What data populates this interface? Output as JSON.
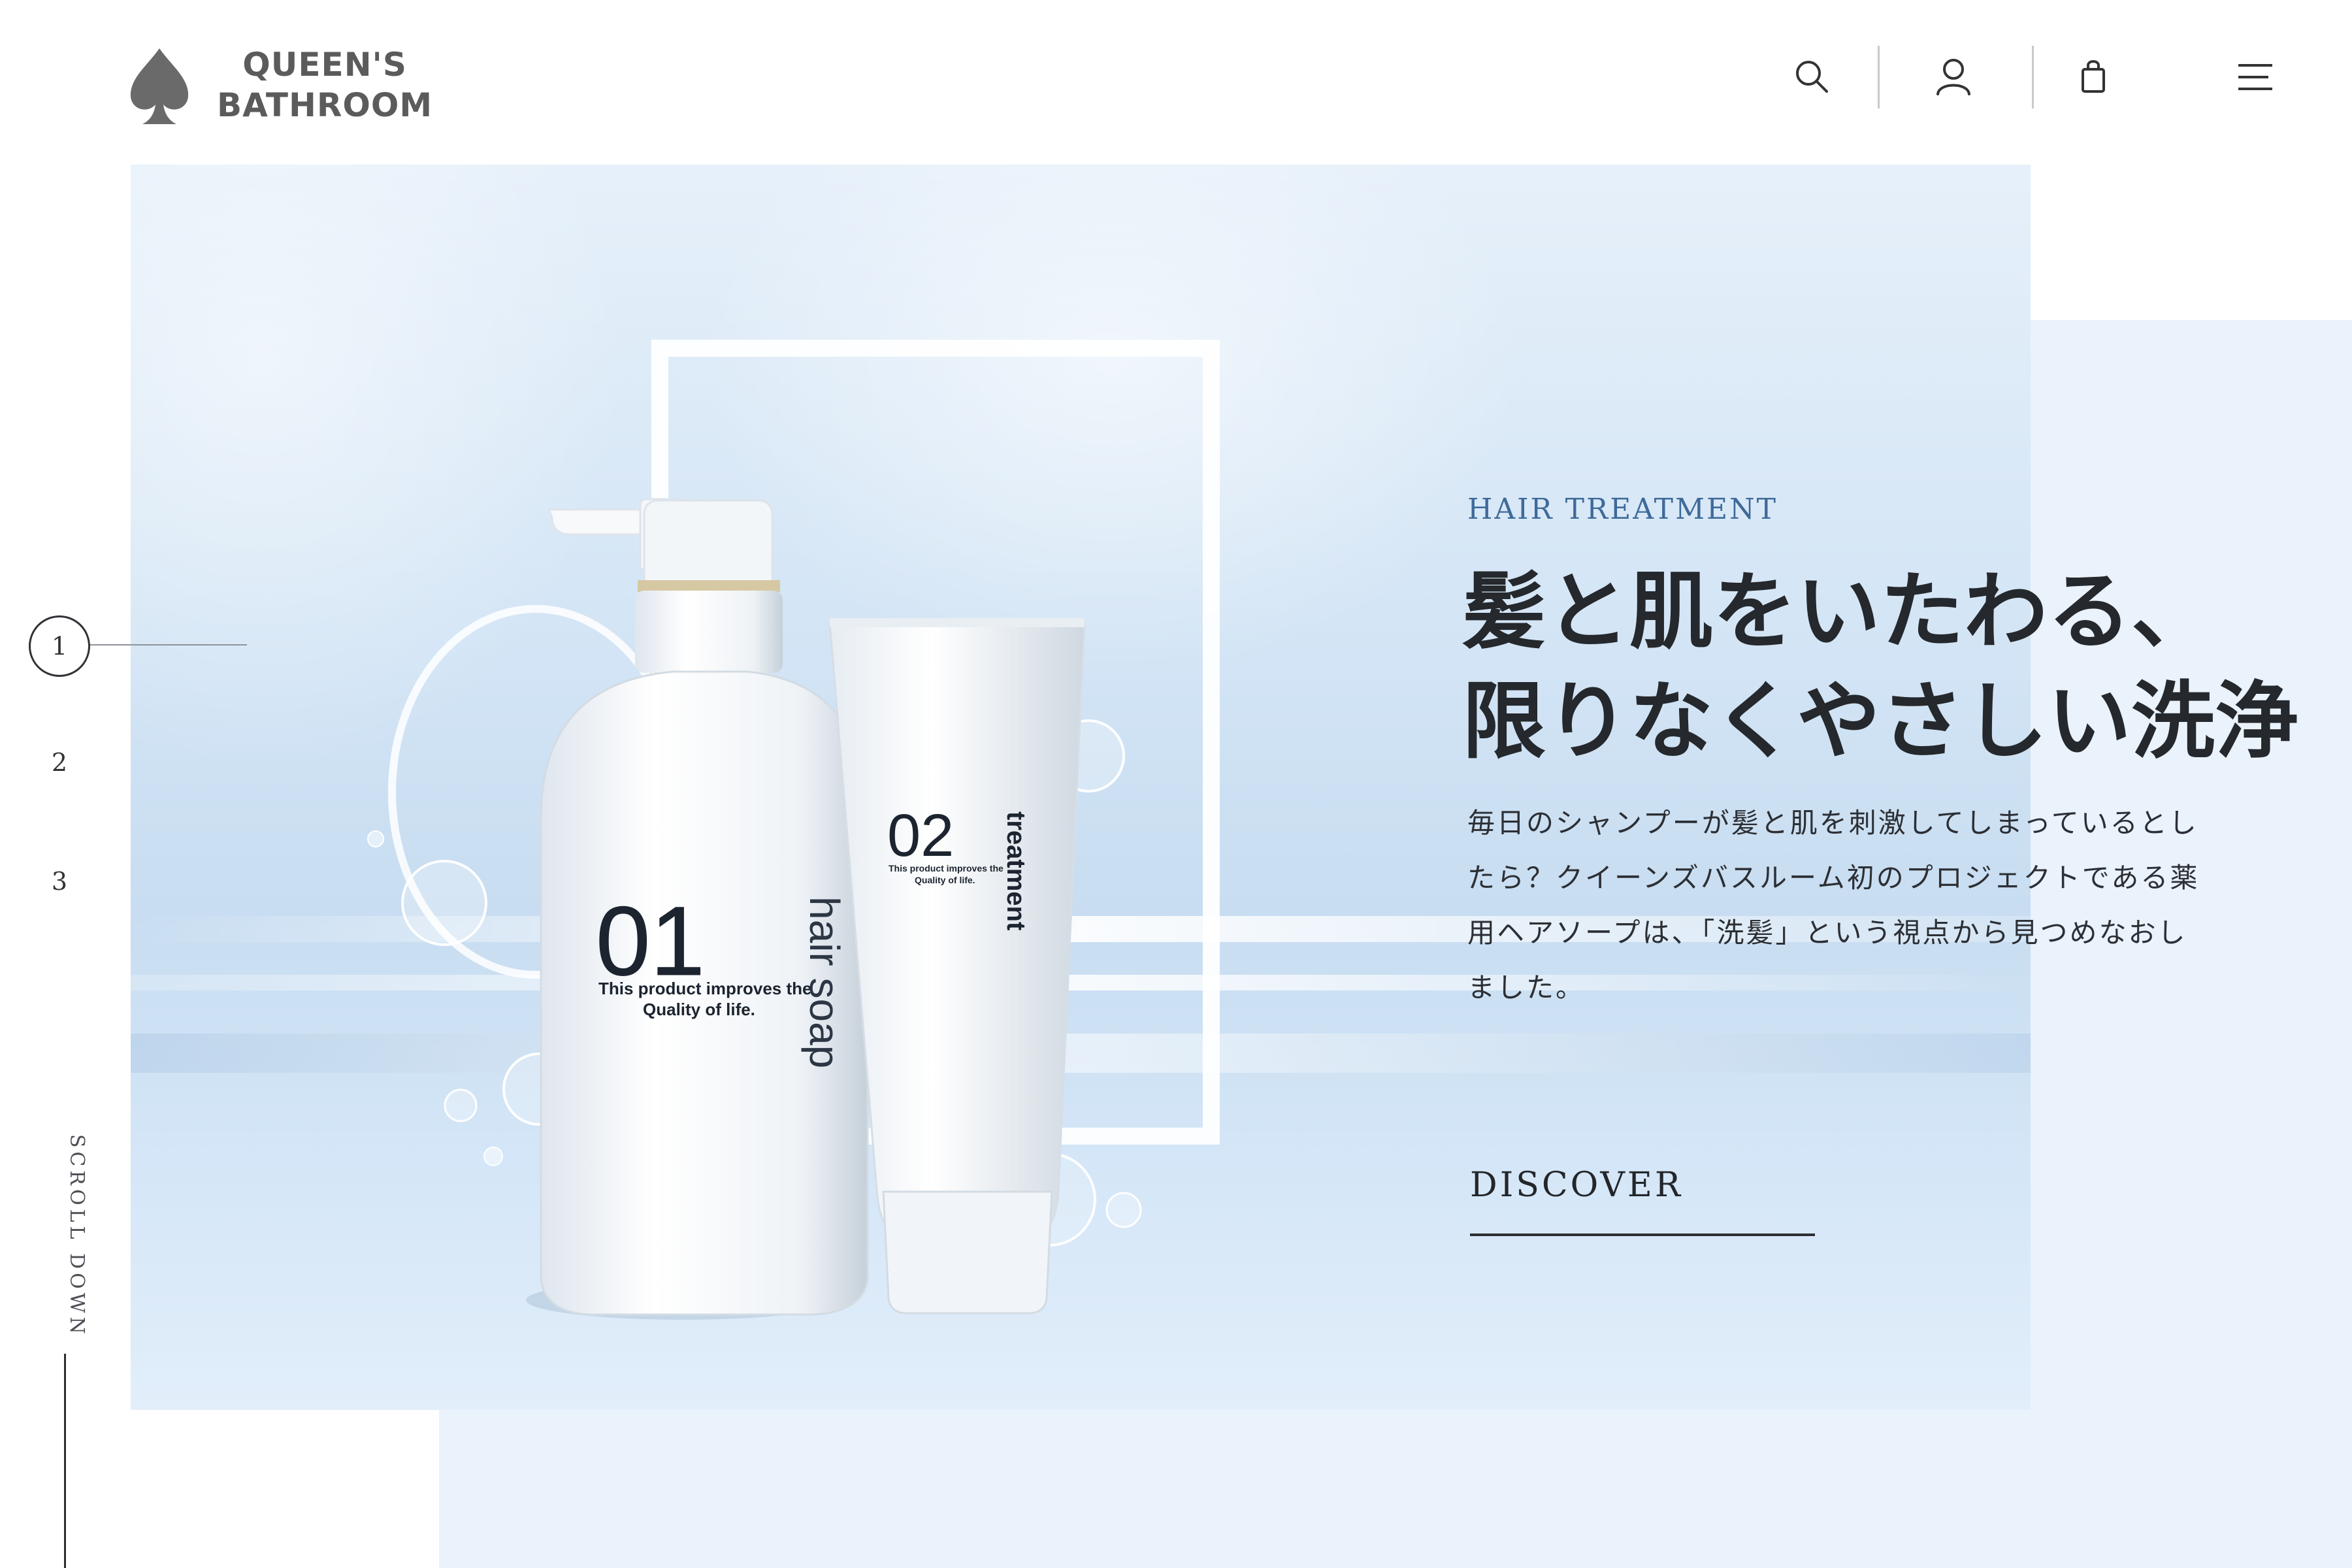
{
  "brand": {
    "line1": "QUEEN'S",
    "line2": "BATHROOM",
    "logo_icon": "spade-icon",
    "color": "#5b5b5b"
  },
  "header": {
    "icons": [
      "search-icon",
      "user-icon",
      "shopping-bag-icon",
      "menu-icon"
    ]
  },
  "hero": {
    "eyebrow": "HAIR TREATMENT",
    "headline": [
      "髪と肌をいたわる、",
      "限りなくやさしい洗浄"
    ],
    "body": "毎日のシャンプーが髪と肌を刺激してしまっているとしたら？クイーンズバスルーム初のプロジェクトである薬用ヘアソープは、「洗髪」という視点から見つめなおしました。",
    "cta": "DISCOVER",
    "accent_color": "#3e6a99"
  },
  "products": {
    "bottle": {
      "number": "01",
      "name": "hair soap",
      "tagline_1": "This product improves the",
      "tagline_2": "Quality of life."
    },
    "tube": {
      "number": "02",
      "name": "treatment",
      "tagline_1": "This product improves the",
      "tagline_2": "Quality of life."
    }
  },
  "slides": {
    "items": [
      "1",
      "2",
      "3"
    ],
    "active_index": 0
  },
  "scroll": {
    "label": "SCROLL DOWN"
  }
}
